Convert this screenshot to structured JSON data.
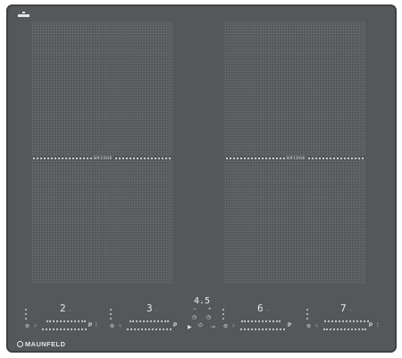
{
  "brand": {
    "name": "MAUNFELD"
  },
  "zones": [
    {
      "id": "front-left"
    },
    {
      "id": "rear-left"
    },
    {
      "id": "front-right"
    },
    {
      "id": "rear-right"
    }
  ],
  "bridge_labels": {
    "left": "BRIDGE",
    "right": "BRIDGE"
  },
  "controls": {
    "power_levels": [
      "2",
      "3",
      "6",
      "7"
    ],
    "timer_value": "4.5",
    "slider_end_label": "P",
    "icons": [
      "pan-icon",
      "settings-icon",
      "play-icon",
      "power-icon",
      "lock-icon"
    ]
  }
}
